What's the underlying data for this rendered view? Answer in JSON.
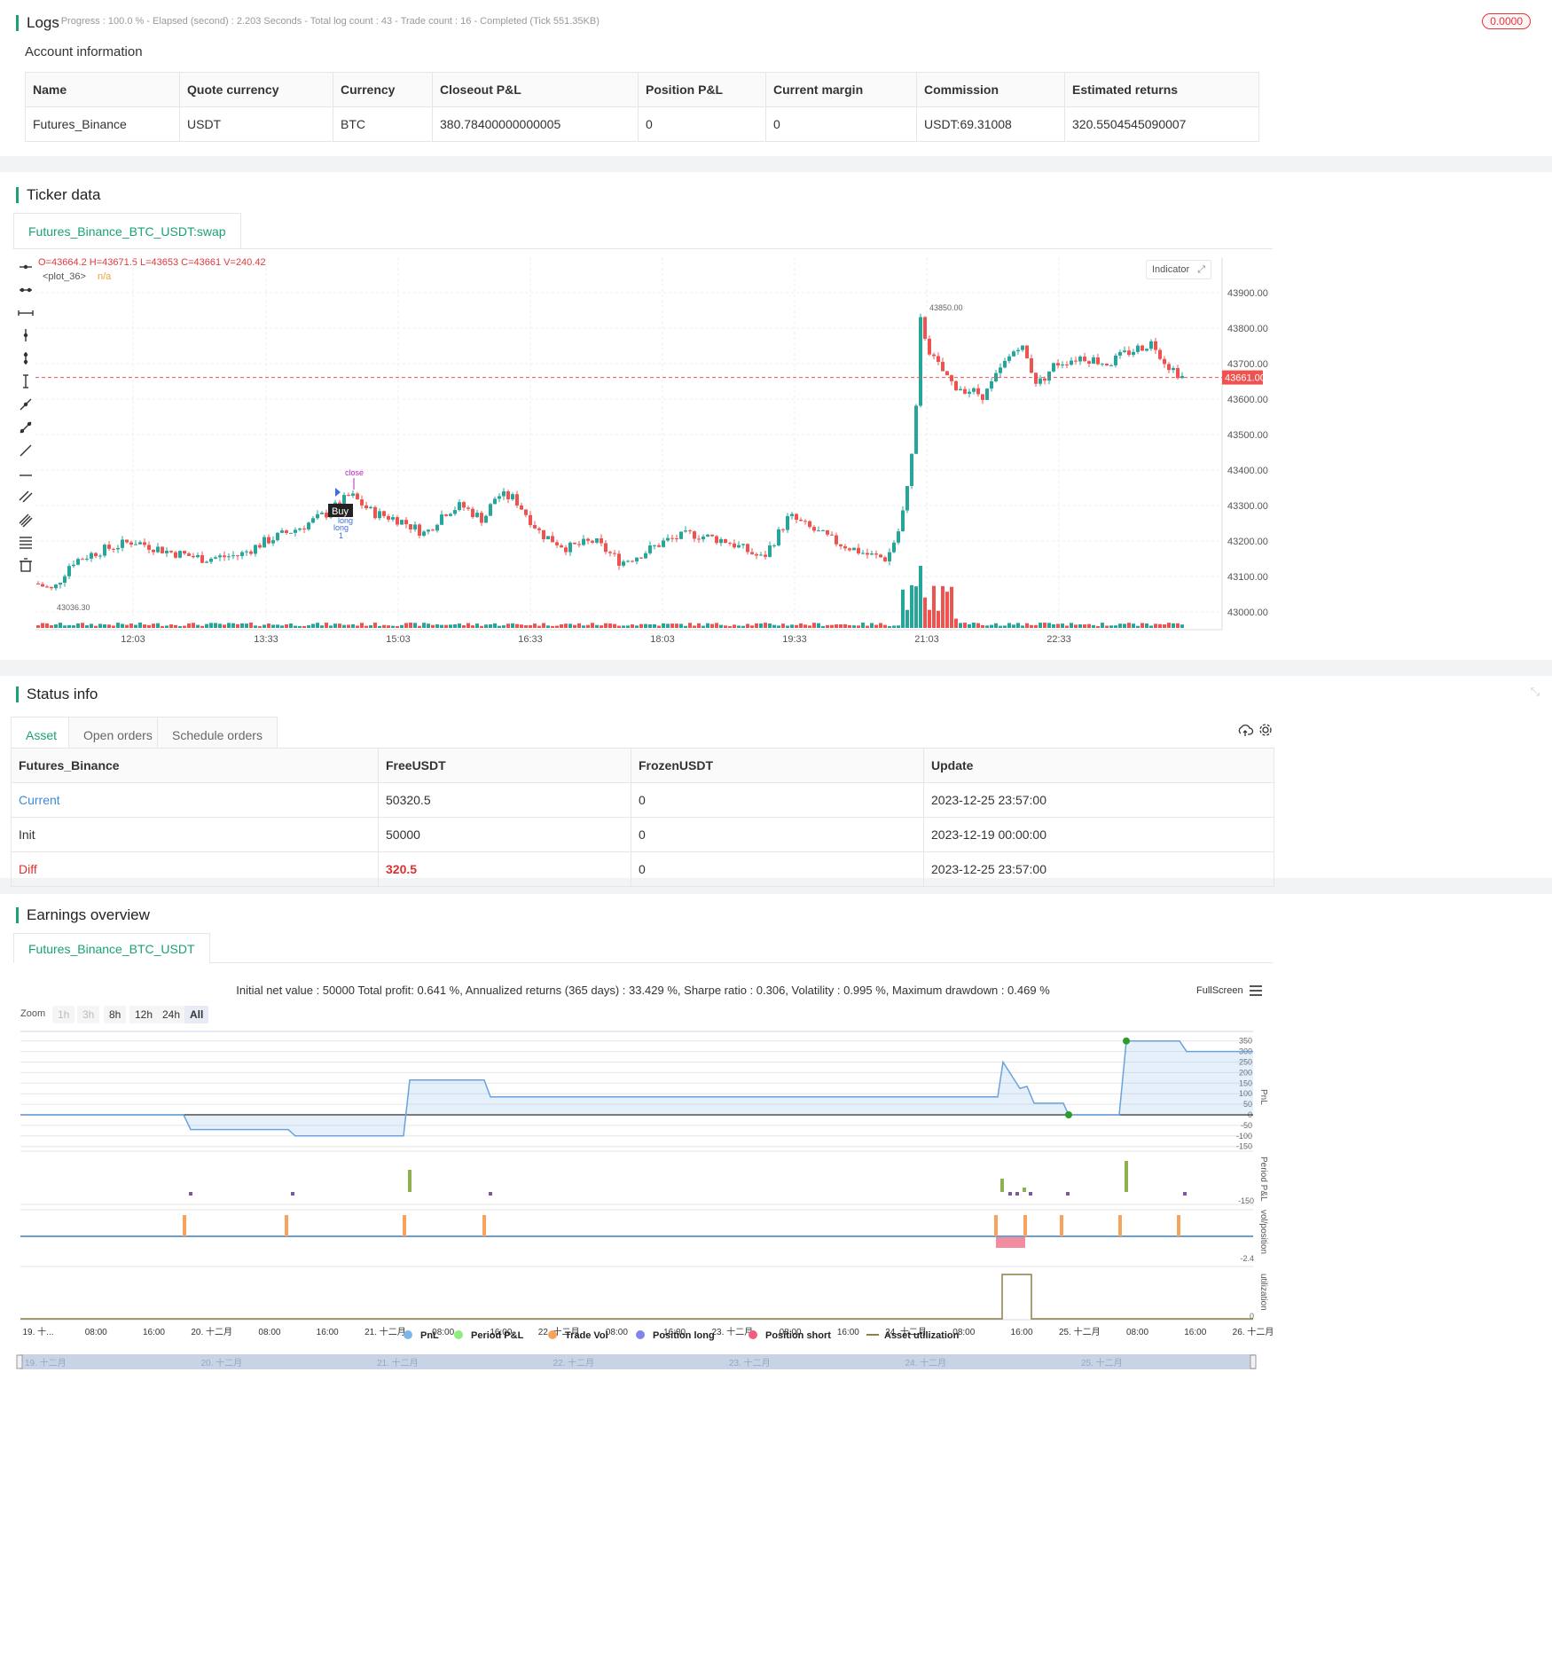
{
  "logs": {
    "title": "Logs",
    "progress": "- Progress : 100.0 % - Elapsed (second) : 2.203  Seconds - Total log count : 43 - Trade count : 16 - Completed (Tick 551.35KB)",
    "badge": "0.0000",
    "account_title": "Account information",
    "columns": [
      "Name",
      "Quote currency",
      "Currency",
      "Closeout P&L",
      "Position P&L",
      "Current margin",
      "Commission",
      "Estimated returns"
    ],
    "row": [
      "Futures_Binance",
      "USDT",
      "BTC",
      "380.78400000000005",
      "0",
      "0",
      "USDT:69.31008",
      "320.5504545090007"
    ]
  },
  "ticker": {
    "title": "Ticker data",
    "tab": "Futures_Binance_BTC_USDT:swap",
    "ohlc": "O=43664.2 H=43671.5 L=43653 C=43661 V=240.42",
    "plot_label": "<plot_36>",
    "plot_value": "n/a",
    "indicator_btn": "Indicator",
    "last_price": "43661.00",
    "high_marker": "43850.00",
    "low_marker": "43036.30",
    "buy_label": "Buy",
    "close_label": "close",
    "long_label1": "long",
    "long_label2": "long",
    "long_qty": "1",
    "y_ticks": [
      "43900.00",
      "43800.00",
      "43700.00",
      "43600.00",
      "43500.00",
      "43400.00",
      "43300.00",
      "43200.00",
      "43100.00",
      "43000.00"
    ],
    "x_ticks": [
      "12:03",
      "13:33",
      "15:03",
      "16:33",
      "18:03",
      "19:33",
      "21:03",
      "22:33"
    ]
  },
  "status": {
    "title": "Status info",
    "tabs": [
      "Asset",
      "Open orders",
      "Schedule orders"
    ],
    "columns": [
      "Futures_Binance",
      "FreeUSDT",
      "FrozenUSDT",
      "Update"
    ],
    "rows": [
      [
        "Current",
        "50320.5",
        "0",
        "2023-12-25 23:57:00"
      ],
      [
        "Init",
        "50000",
        "0",
        "2023-12-19 00:00:00"
      ],
      [
        "Diff",
        "320.5",
        "0",
        "2023-12-25 23:57:00"
      ]
    ]
  },
  "earnings": {
    "title": "Earnings overview",
    "tab": "Futures_Binance_BTC_USDT",
    "summary": "Initial net value : 50000 Total profit: 0.641 %, Annualized returns (365 days) : 33.429 %, Sharpe ratio : 0.306, Volatility : 0.995 %, Maximum drawdown : 0.469 %",
    "fullscreen": "FullScreen",
    "zoom_label": "Zoom",
    "zoom_buttons": [
      "1h",
      "3h",
      "8h",
      "12h",
      "24h",
      "All"
    ],
    "pnl_ticks": [
      "350",
      "300",
      "250",
      "200",
      "150",
      "100",
      "50",
      "0",
      "-50",
      "-100",
      "-150"
    ],
    "axis_names": [
      "PnL",
      "Period P&L",
      "vol/position",
      "utilization"
    ],
    "period_min": "-150",
    "vol_min": "-2.4",
    "util_min": "0",
    "x_ticks": [
      "19. 十...",
      "08:00",
      "16:00",
      "20. 十二月",
      "08:00",
      "16:00",
      "21. 十二月",
      "08:00",
      "16:00",
      "22. 十二月",
      "08:00",
      "16:00",
      "23. 十二月",
      "08:00",
      "16:00",
      "24. 十二月",
      "08:00",
      "16:00",
      "25. 十二月",
      "08:00",
      "16:00",
      "26. 十二月"
    ],
    "nav_ticks": [
      "19. 十二月",
      "20. 十二月",
      "21. 十二月",
      "22. 十二月",
      "23. 十二月",
      "24. 十二月",
      "25. 十二月"
    ],
    "legend": [
      {
        "name": "PnL",
        "color": "#7cb5ec"
      },
      {
        "name": "Period P&L",
        "color": "#90ed7d"
      },
      {
        "name": "Trade Vol",
        "color": "#f7a35c"
      },
      {
        "name": "Position long",
        "color": "#8085e9"
      },
      {
        "name": "Position short",
        "color": "#f15c80"
      },
      {
        "name": "Asset utilization",
        "color": "#8d7e4a"
      }
    ]
  },
  "colors": {
    "accent": "#1aa179",
    "up": "#26a69a",
    "down": "#ef5350",
    "link": "#3d8bd9",
    "diff": "#e02f2f"
  }
}
